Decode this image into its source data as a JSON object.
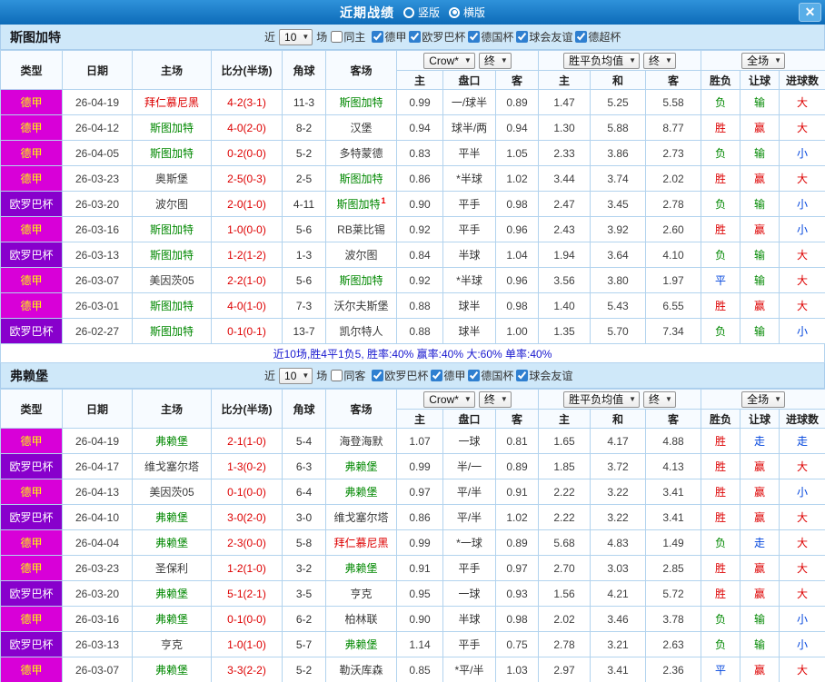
{
  "topbar": {
    "title": "近期战绩",
    "radios": [
      {
        "label": "竖版",
        "selected": false
      },
      {
        "label": "横版",
        "selected": true
      }
    ],
    "close_icon": "✕"
  },
  "colors": {
    "topbar_bg": "#1478c8",
    "section_bg": "#cfe8f9",
    "border": "#b2d3ee",
    "league_colors": {
      "德甲": {
        "bg": "#d800d8",
        "fg": "#ffff00"
      },
      "欧罗巴杯": {
        "bg": "#8800cc",
        "fg": "#ffffff"
      }
    },
    "team_colors": {
      "self": "#008800",
      "rival": "#dd0000",
      "norm": "#3a3a3a"
    },
    "result_colors": {
      "red": "#dd0000",
      "blue": "#0044dd",
      "green": "#008800"
    },
    "score_color": "#dd0000"
  },
  "table_headers": {
    "type": "类型",
    "date": "日期",
    "home": "主场",
    "score": "比分(半场)",
    "corner": "角球",
    "away": "客场",
    "h": "主",
    "handicap": "盘口",
    "a": "客",
    "avg_h": "主",
    "avg_d": "和",
    "avg_a": "客",
    "wdl": "胜负",
    "let": "让球",
    "goals": "进球数"
  },
  "sections": [
    {
      "team": "斯图加特",
      "near": "近",
      "count": "10",
      "games": "场",
      "same": {
        "label": "同主",
        "checked": false
      },
      "leagues": [
        {
          "label": "德甲",
          "checked": true
        },
        {
          "label": "欧罗巴杯",
          "checked": true
        },
        {
          "label": "德国杯",
          "checked": true
        },
        {
          "label": "球会友谊",
          "checked": true
        },
        {
          "label": "德超杯",
          "checked": true
        }
      ],
      "dropdowns": {
        "odds": "Crow*",
        "odds_state": "终",
        "avg": "胜平负均值",
        "avg_state": "终",
        "scope": "全场"
      },
      "summary": "近10场,胜4平1负5, 胜率:40% 赢率:40% 大:60% 单率:40%",
      "rows": [
        {
          "league": "德甲",
          "date": "26-04-19",
          "home": "拜仁慕尼黑",
          "home_c": "rival",
          "score": "4-2(3-1)",
          "corner": "11-3",
          "away": "斯图加特",
          "away_c": "self",
          "odds_h": "0.99",
          "handicap": "一/球半",
          "odds_a": "0.89",
          "avg_h": "1.47",
          "avg_d": "5.25",
          "avg_a": "5.58",
          "wdl": "负",
          "let": "输",
          "goals": "大"
        },
        {
          "league": "德甲",
          "date": "26-04-12",
          "home": "斯图加特",
          "home_c": "self",
          "score": "4-0(2-0)",
          "corner": "8-2",
          "away": "汉堡",
          "away_c": "norm",
          "odds_h": "0.94",
          "handicap": "球半/两",
          "odds_a": "0.94",
          "avg_h": "1.30",
          "avg_d": "5.88",
          "avg_a": "8.77",
          "wdl": "胜",
          "let": "赢",
          "goals": "大"
        },
        {
          "league": "德甲",
          "date": "26-04-05",
          "home": "斯图加特",
          "home_c": "self",
          "score": "0-2(0-0)",
          "corner": "5-2",
          "away": "多特蒙德",
          "away_c": "norm",
          "odds_h": "0.83",
          "handicap": "平半",
          "odds_a": "1.05",
          "avg_h": "2.33",
          "avg_d": "3.86",
          "avg_a": "2.73",
          "wdl": "负",
          "let": "输",
          "goals": "小"
        },
        {
          "league": "德甲",
          "date": "26-03-23",
          "home": "奥斯堡",
          "home_c": "norm",
          "score": "2-5(0-3)",
          "corner": "2-5",
          "away": "斯图加特",
          "away_c": "self",
          "odds_h": "0.86",
          "handicap": "*半球",
          "odds_a": "1.02",
          "avg_h": "3.44",
          "avg_d": "3.74",
          "avg_a": "2.02",
          "wdl": "胜",
          "let": "赢",
          "goals": "大"
        },
        {
          "league": "欧罗巴杯",
          "date": "26-03-20",
          "home": "波尔图",
          "home_c": "norm",
          "score": "2-0(1-0)",
          "corner": "4-11",
          "away": "斯图加特",
          "away_c": "self",
          "away_sup": "1",
          "odds_h": "0.90",
          "handicap": "平手",
          "odds_a": "0.98",
          "avg_h": "2.47",
          "avg_d": "3.45",
          "avg_a": "2.78",
          "wdl": "负",
          "let": "输",
          "goals": "小"
        },
        {
          "league": "德甲",
          "date": "26-03-16",
          "home": "斯图加特",
          "home_c": "self",
          "score": "1-0(0-0)",
          "corner": "5-6",
          "away": "RB莱比锡",
          "away_c": "norm",
          "odds_h": "0.92",
          "handicap": "平手",
          "odds_a": "0.96",
          "avg_h": "2.43",
          "avg_d": "3.92",
          "avg_a": "2.60",
          "wdl": "胜",
          "let": "赢",
          "goals": "小"
        },
        {
          "league": "欧罗巴杯",
          "date": "26-03-13",
          "home": "斯图加特",
          "home_c": "self",
          "score": "1-2(1-2)",
          "corner": "1-3",
          "away": "波尔图",
          "away_c": "norm",
          "odds_h": "0.84",
          "handicap": "半球",
          "odds_a": "1.04",
          "avg_h": "1.94",
          "avg_d": "3.64",
          "avg_a": "4.10",
          "wdl": "负",
          "let": "输",
          "goals": "大"
        },
        {
          "league": "德甲",
          "date": "26-03-07",
          "home": "美因茨05",
          "home_c": "norm",
          "score": "2-2(1-0)",
          "corner": "5-6",
          "away": "斯图加特",
          "away_c": "self",
          "odds_h": "0.92",
          "handicap": "*半球",
          "odds_a": "0.96",
          "avg_h": "3.56",
          "avg_d": "3.80",
          "avg_a": "1.97",
          "wdl": "平",
          "let": "输",
          "goals": "大"
        },
        {
          "league": "德甲",
          "date": "26-03-01",
          "home": "斯图加特",
          "home_c": "self",
          "score": "4-0(1-0)",
          "corner": "7-3",
          "away": "沃尔夫斯堡",
          "away_c": "norm",
          "odds_h": "0.88",
          "handicap": "球半",
          "odds_a": "0.98",
          "avg_h": "1.40",
          "avg_d": "5.43",
          "avg_a": "6.55",
          "wdl": "胜",
          "let": "赢",
          "goals": "大"
        },
        {
          "league": "欧罗巴杯",
          "date": "26-02-27",
          "home": "斯图加特",
          "home_c": "self",
          "score": "0-1(0-1)",
          "corner": "13-7",
          "away": "凯尔特人",
          "away_c": "norm",
          "odds_h": "0.88",
          "handicap": "球半",
          "odds_a": "1.00",
          "avg_h": "1.35",
          "avg_d": "5.70",
          "avg_a": "7.34",
          "wdl": "负",
          "let": "输",
          "goals": "小"
        }
      ]
    },
    {
      "team": "弗赖堡",
      "near": "近",
      "count": "10",
      "games": "场",
      "same": {
        "label": "同客",
        "checked": false
      },
      "leagues": [
        {
          "label": "欧罗巴杯",
          "checked": true
        },
        {
          "label": "德甲",
          "checked": true
        },
        {
          "label": "德国杯",
          "checked": true
        },
        {
          "label": "球会友谊",
          "checked": true
        }
      ],
      "dropdowns": {
        "odds": "Crow*",
        "odds_state": "终",
        "avg": "胜平负均值",
        "avg_state": "终",
        "scope": "全场"
      },
      "summary": "",
      "rows": [
        {
          "league": "德甲",
          "date": "26-04-19",
          "home": "弗赖堡",
          "home_c": "self",
          "score": "2-1(1-0)",
          "corner": "5-4",
          "away": "海登海默",
          "away_c": "norm",
          "odds_h": "1.07",
          "handicap": "一球",
          "odds_a": "0.81",
          "avg_h": "1.65",
          "avg_d": "4.17",
          "avg_a": "4.88",
          "wdl": "胜",
          "let": "走",
          "goals": "走"
        },
        {
          "league": "欧罗巴杯",
          "date": "26-04-17",
          "home": "维戈塞尔塔",
          "home_c": "norm",
          "score": "1-3(0-2)",
          "corner": "6-3",
          "away": "弗赖堡",
          "away_c": "self",
          "odds_h": "0.99",
          "handicap": "半/一",
          "odds_a": "0.89",
          "avg_h": "1.85",
          "avg_d": "3.72",
          "avg_a": "4.13",
          "wdl": "胜",
          "let": "赢",
          "goals": "大"
        },
        {
          "league": "德甲",
          "date": "26-04-13",
          "home": "美因茨05",
          "home_c": "norm",
          "score": "0-1(0-0)",
          "corner": "6-4",
          "away": "弗赖堡",
          "away_c": "self",
          "odds_h": "0.97",
          "handicap": "平/半",
          "odds_a": "0.91",
          "avg_h": "2.22",
          "avg_d": "3.22",
          "avg_a": "3.41",
          "wdl": "胜",
          "let": "赢",
          "goals": "小"
        },
        {
          "league": "欧罗巴杯",
          "date": "26-04-10",
          "home": "弗赖堡",
          "home_c": "self",
          "score": "3-0(2-0)",
          "corner": "3-0",
          "away": "维戈塞尔塔",
          "away_c": "norm",
          "odds_h": "0.86",
          "handicap": "平/半",
          "odds_a": "1.02",
          "avg_h": "2.22",
          "avg_d": "3.22",
          "avg_a": "3.41",
          "wdl": "胜",
          "let": "赢",
          "goals": "大"
        },
        {
          "league": "德甲",
          "date": "26-04-04",
          "home": "弗赖堡",
          "home_c": "self",
          "score": "2-3(0-0)",
          "corner": "5-8",
          "away": "拜仁慕尼黑",
          "away_c": "rival",
          "odds_h": "0.99",
          "handicap": "*一球",
          "odds_a": "0.89",
          "avg_h": "5.68",
          "avg_d": "4.83",
          "avg_a": "1.49",
          "wdl": "负",
          "let": "走",
          "goals": "大"
        },
        {
          "league": "德甲",
          "date": "26-03-23",
          "home": "圣保利",
          "home_c": "norm",
          "score": "1-2(1-0)",
          "corner": "3-2",
          "away": "弗赖堡",
          "away_c": "self",
          "odds_h": "0.91",
          "handicap": "平手",
          "odds_a": "0.97",
          "avg_h": "2.70",
          "avg_d": "3.03",
          "avg_a": "2.85",
          "wdl": "胜",
          "let": "赢",
          "goals": "大"
        },
        {
          "league": "欧罗巴杯",
          "date": "26-03-20",
          "home": "弗赖堡",
          "home_c": "self",
          "score": "5-1(2-1)",
          "corner": "3-5",
          "away": "亨克",
          "away_c": "norm",
          "odds_h": "0.95",
          "handicap": "一球",
          "odds_a": "0.93",
          "avg_h": "1.56",
          "avg_d": "4.21",
          "avg_a": "5.72",
          "wdl": "胜",
          "let": "赢",
          "goals": "大"
        },
        {
          "league": "德甲",
          "date": "26-03-16",
          "home": "弗赖堡",
          "home_c": "self",
          "score": "0-1(0-0)",
          "corner": "6-2",
          "away": "柏林联",
          "away_c": "norm",
          "odds_h": "0.90",
          "handicap": "半球",
          "odds_a": "0.98",
          "avg_h": "2.02",
          "avg_d": "3.46",
          "avg_a": "3.78",
          "wdl": "负",
          "let": "输",
          "goals": "小"
        },
        {
          "league": "欧罗巴杯",
          "date": "26-03-13",
          "home": "亨克",
          "home_c": "norm",
          "score": "1-0(1-0)",
          "corner": "5-7",
          "away": "弗赖堡",
          "away_c": "self",
          "odds_h": "1.14",
          "handicap": "平手",
          "odds_a": "0.75",
          "avg_h": "2.78",
          "avg_d": "3.21",
          "avg_a": "2.63",
          "wdl": "负",
          "let": "输",
          "goals": "小"
        },
        {
          "league": "德甲",
          "date": "26-03-07",
          "home": "弗赖堡",
          "home_c": "self",
          "score": "3-3(2-2)",
          "corner": "5-2",
          "away": "勒沃库森",
          "away_c": "norm",
          "odds_h": "0.85",
          "handicap": "*平/半",
          "odds_a": "1.03",
          "avg_h": "2.97",
          "avg_d": "3.41",
          "avg_a": "2.36",
          "wdl": "平",
          "let": "赢",
          "goals": "大"
        }
      ]
    }
  ]
}
